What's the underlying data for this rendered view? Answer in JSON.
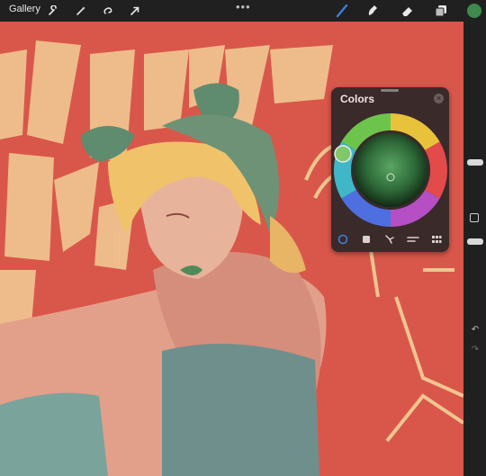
{
  "toolbar": {
    "gallery_label": "Gallery",
    "tools": [
      "wrench-icon",
      "magic-wand-icon",
      "selection-icon",
      "transform-arrow-icon"
    ],
    "more": "•••",
    "right_tools": [
      "brush-icon",
      "smudge-icon",
      "eraser-icon",
      "layers-icon"
    ],
    "current_color": "#3d8a4c",
    "active_color": "#3f7fd9"
  },
  "colors_panel": {
    "title": "Colors",
    "close": "×",
    "tabs": [
      "disc-tab",
      "classic-tab",
      "harmony-tab",
      "value-tab",
      "palettes-tab"
    ]
  },
  "sidebar": {
    "undo": "↶",
    "redo": "↷"
  },
  "artwork": {
    "background": "#d9574a",
    "lettering_color": "#f0c590"
  }
}
